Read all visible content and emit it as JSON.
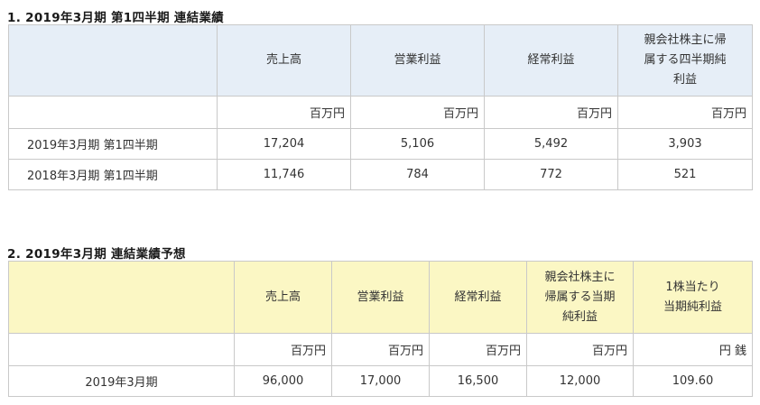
{
  "section1": {
    "title": "1. 2019年3月期 第1四半期 連結業績",
    "headers": [
      "売上高",
      "営業利益",
      "経常利益",
      "親会社株主に帰属する四半期純利益"
    ],
    "header_lines": [
      [
        "売上高"
      ],
      [
        "営業利益"
      ],
      [
        "経常利益"
      ],
      [
        "親会社株主に帰",
        "属する四半期純",
        "利益"
      ]
    ],
    "units": [
      "百万円",
      "百万円",
      "百万円",
      "百万円"
    ],
    "rows": [
      {
        "label": "2019年3月期 第1四半期",
        "values": [
          "17,204",
          "5,106",
          "5,492",
          "3,903"
        ]
      },
      {
        "label": "2018年3月期 第1四半期",
        "values": [
          "11,746",
          "784",
          "772",
          "521"
        ]
      }
    ]
  },
  "section2": {
    "title": "2. 2019年3月期 連結業績予想",
    "header_lines": [
      [
        "売上高"
      ],
      [
        "営業利益"
      ],
      [
        "経常利益"
      ],
      [
        "親会社株主に",
        "帰属する当期",
        "純利益"
      ],
      [
        "1株当たり",
        "当期純利益"
      ]
    ],
    "units": [
      "百万円",
      "百万円",
      "百万円",
      "百万円",
      "円 銭"
    ],
    "rows": [
      {
        "label": "2019年3月期",
        "values": [
          "96,000",
          "17,000",
          "16,500",
          "12,000",
          "109.60"
        ]
      }
    ]
  },
  "colors": {
    "header_blue": "#e6eef7",
    "header_yellow": "#fbf7c4",
    "border": "#c9c9c9"
  }
}
